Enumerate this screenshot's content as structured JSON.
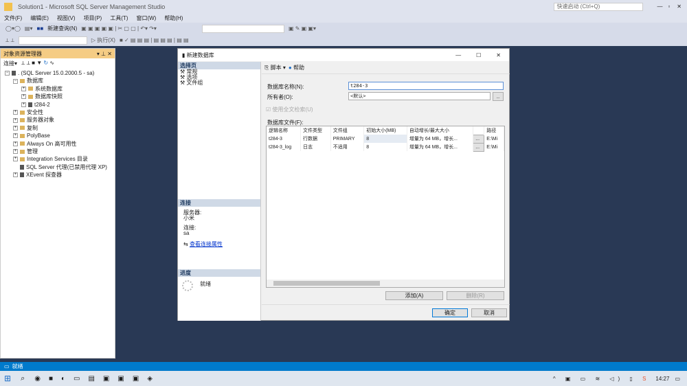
{
  "app": {
    "title": "Solution1 - Microsoft SQL Server Management Studio",
    "quick_launch": "快速启动 (Ctrl+Q)"
  },
  "menu": [
    "文件(F)",
    "编辑(E)",
    "视图(V)",
    "项目(P)",
    "工具(T)",
    "窗口(W)",
    "帮助(H)"
  ],
  "toolbar": {
    "new_query": "新建查询(N)",
    "execute": "执行(X)"
  },
  "object_explorer": {
    "title": "对象资源管理器",
    "connect": "连接",
    "tree": [
      {
        "label": ". (SQL Server 15.0.2000.5 - sa)",
        "level": 0,
        "icon": "server-icon"
      },
      {
        "label": "数据库",
        "level": 1,
        "icon": "folder-icon"
      },
      {
        "label": "系统数据库",
        "level": 2,
        "icon": "folder-icon"
      },
      {
        "label": "数据库快照",
        "level": 2,
        "icon": "folder-icon"
      },
      {
        "label": "t284-2",
        "level": 2,
        "icon": "database-icon"
      },
      {
        "label": "安全性",
        "level": 1,
        "icon": "folder-icon"
      },
      {
        "label": "服务器对象",
        "level": 1,
        "icon": "folder-icon"
      },
      {
        "label": "复制",
        "level": 1,
        "icon": "folder-icon"
      },
      {
        "label": "PolyBase",
        "level": 1,
        "icon": "folder-icon"
      },
      {
        "label": "Always On 高可用性",
        "level": 1,
        "icon": "folder-icon"
      },
      {
        "label": "管理",
        "level": 1,
        "icon": "folder-icon"
      },
      {
        "label": "Integration Services 目录",
        "level": 1,
        "icon": "folder-icon"
      },
      {
        "label": "SQL Server 代理(已禁用代理 XP)",
        "level": 1,
        "icon": "agent-icon"
      },
      {
        "label": "XEvent 探查器",
        "level": 1,
        "icon": "xevent-icon"
      }
    ]
  },
  "dialog": {
    "title": "新建数据库",
    "select_page": "选择页",
    "pages": [
      "常规",
      "选项",
      "文件组"
    ],
    "connection": {
      "header": "连接",
      "server_label": "服务器:",
      "server": "小米",
      "conn_label": "连接:",
      "conn": "sa",
      "view_props": "查看连接属性"
    },
    "progress": {
      "header": "进度",
      "status": "就绪"
    },
    "script": "脚本",
    "help": "帮助",
    "db_name_label": "数据库名称(N):",
    "db_name": "t284-3",
    "owner_label": "所有者(O):",
    "owner": "<默认>",
    "fulltext": "使用全文检索(U)",
    "files_label": "数据库文件(F):",
    "columns": [
      "逻辑名称",
      "文件类型",
      "文件组",
      "初始大小(MB)",
      "自动增长/最大大小",
      "",
      "路径"
    ],
    "rows": [
      [
        "t284-3",
        "行数据",
        "PRIMARY",
        "8",
        "增量为 64 MB，增长...",
        "...",
        "E:\\Mi"
      ],
      [
        "t284-3_log",
        "日志",
        "不适用",
        "8",
        "增量为 64 MB，增长...",
        "...",
        "E:\\Mi"
      ]
    ],
    "add": "添加(A)",
    "remove": "删除(R)",
    "ok": "确定",
    "cancel": "取消"
  },
  "status": {
    "text": "就绪"
  },
  "taskbar": {
    "time": "14:27"
  },
  "colors": {
    "accent": "#007acc",
    "background": "#293955",
    "panel_header": "#f5cc84"
  }
}
